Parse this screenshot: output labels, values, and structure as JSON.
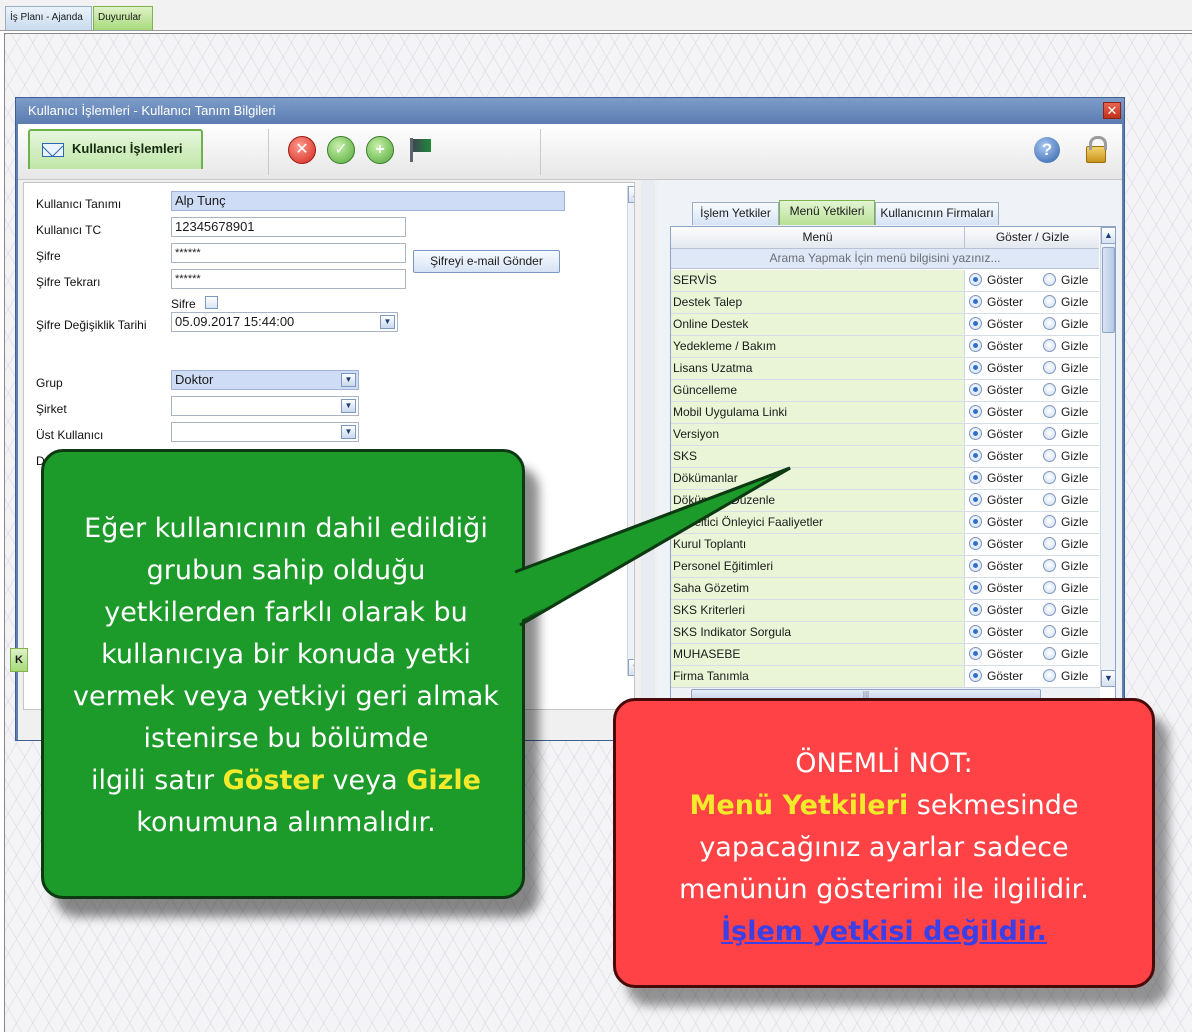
{
  "app_tabs": [
    {
      "label": "İş Planı - Ajanda"
    },
    {
      "label": "Duyurular"
    }
  ],
  "dialog": {
    "title": "Kullanıcı İşlemleri - Kullanıcı Tanım Bilgileri",
    "close_glyph": "✕",
    "toolbar": {
      "tab_label": "Kullanıcı İşlemleri",
      "delete_glyph": "✕",
      "ok_glyph": "✓",
      "add_glyph": "+",
      "help_glyph": "?"
    }
  },
  "form": {
    "kullanici_tanimi": {
      "label": "Kullanıcı Tanımı",
      "value": "Alp Tunç"
    },
    "kullanici_tc": {
      "label": "Kullanıcı TC",
      "value": "12345678901"
    },
    "sifre": {
      "label": "Şifre",
      "value": "******"
    },
    "sifre_tekrari": {
      "label": "Şifre Tekrarı",
      "value": "******"
    },
    "sifre_mail_button": "Şifreyi e-mail Gönder",
    "sifre_checkbox_label": "Sifre",
    "sifre_degisiklik": {
      "label": "Şifre Değişiklik Tarihi",
      "value": "05.09.2017 15:44:00"
    },
    "grup": {
      "label": "Grup",
      "value": "Doktor"
    },
    "sirket": {
      "label": "Şirket",
      "value": ""
    },
    "ust_kullanici": {
      "label": "Üst Kullanıcı",
      "value": ""
    },
    "cut_label": "Da",
    "bottom_tab_fragment": "K"
  },
  "right_panel": {
    "tabs": [
      "İşlem Yetkiler",
      "Menü Yetkileri",
      "Kullanıcının Firmaları"
    ],
    "grid": {
      "col_menu": "Menü",
      "col_show_hide": "Göster / Gizle",
      "search_placeholder": "Arama Yapmak İçin menü bilgisini yazınız...",
      "show_label": "Göster",
      "hide_label": "Gizle",
      "rows": [
        {
          "name": "SERVİS",
          "shown": true
        },
        {
          "name": "Destek Talep",
          "shown": true
        },
        {
          "name": "Online Destek",
          "shown": true
        },
        {
          "name": "Yedekleme / Bakım",
          "shown": true
        },
        {
          "name": "Lisans Uzatma",
          "shown": true
        },
        {
          "name": "Güncelleme",
          "shown": true
        },
        {
          "name": "Mobil Uygulama Linki",
          "shown": true
        },
        {
          "name": "Versiyon",
          "shown": true
        },
        {
          "name": "SKS",
          "shown": true
        },
        {
          "name": "Dökümanlar",
          "shown": true
        },
        {
          "name": "Dökümanı Düzenle",
          "shown": true
        },
        {
          "name": "Düzeltici Önleyici Faaliyetler",
          "shown": true
        },
        {
          "name": "Kurul Toplantı",
          "shown": true
        },
        {
          "name": "Personel Eğitimleri",
          "shown": true
        },
        {
          "name": "Saha Gözetim",
          "shown": true
        },
        {
          "name": "SKS Kriterleri",
          "shown": true
        },
        {
          "name": "SKS Indikator Sorgula",
          "shown": true
        },
        {
          "name": "MUHASEBE",
          "shown": true
        },
        {
          "name": "Firma Tanımla",
          "shown": true
        }
      ]
    }
  },
  "callout_green": {
    "lines": [
      "Eğer kullanıcının dahil edildiği",
      "grubun sahip olduğu",
      "yetkilerden farklı olarak bu",
      "kullanıcıya bir konuda yetki",
      "vermek veya yetkiyi geri almak",
      "istenirse bu bölümde"
    ],
    "line7_a": "ilgili satır ",
    "line7_show": "Göster",
    "line7_b": " veya ",
    "line7_hide": "Gizle",
    "line8": "konumuna alınmalıdır."
  },
  "callout_red": {
    "title": "ÖNEMLİ NOT:",
    "highlight": "Menü Yetkileri",
    "line1_rest": " sekmesinde",
    "line2": "yapacağınız ayarlar sadece",
    "line3": "menünün gösterimi ile ilgilidir.",
    "link": "İşlem yetkisi değildir."
  },
  "colors": {
    "green_callout": "#1c9a2a",
    "red_callout": "#ff4245",
    "highlight_yellow": "#f3ea2b",
    "active_tab_green": "#b8e095"
  }
}
